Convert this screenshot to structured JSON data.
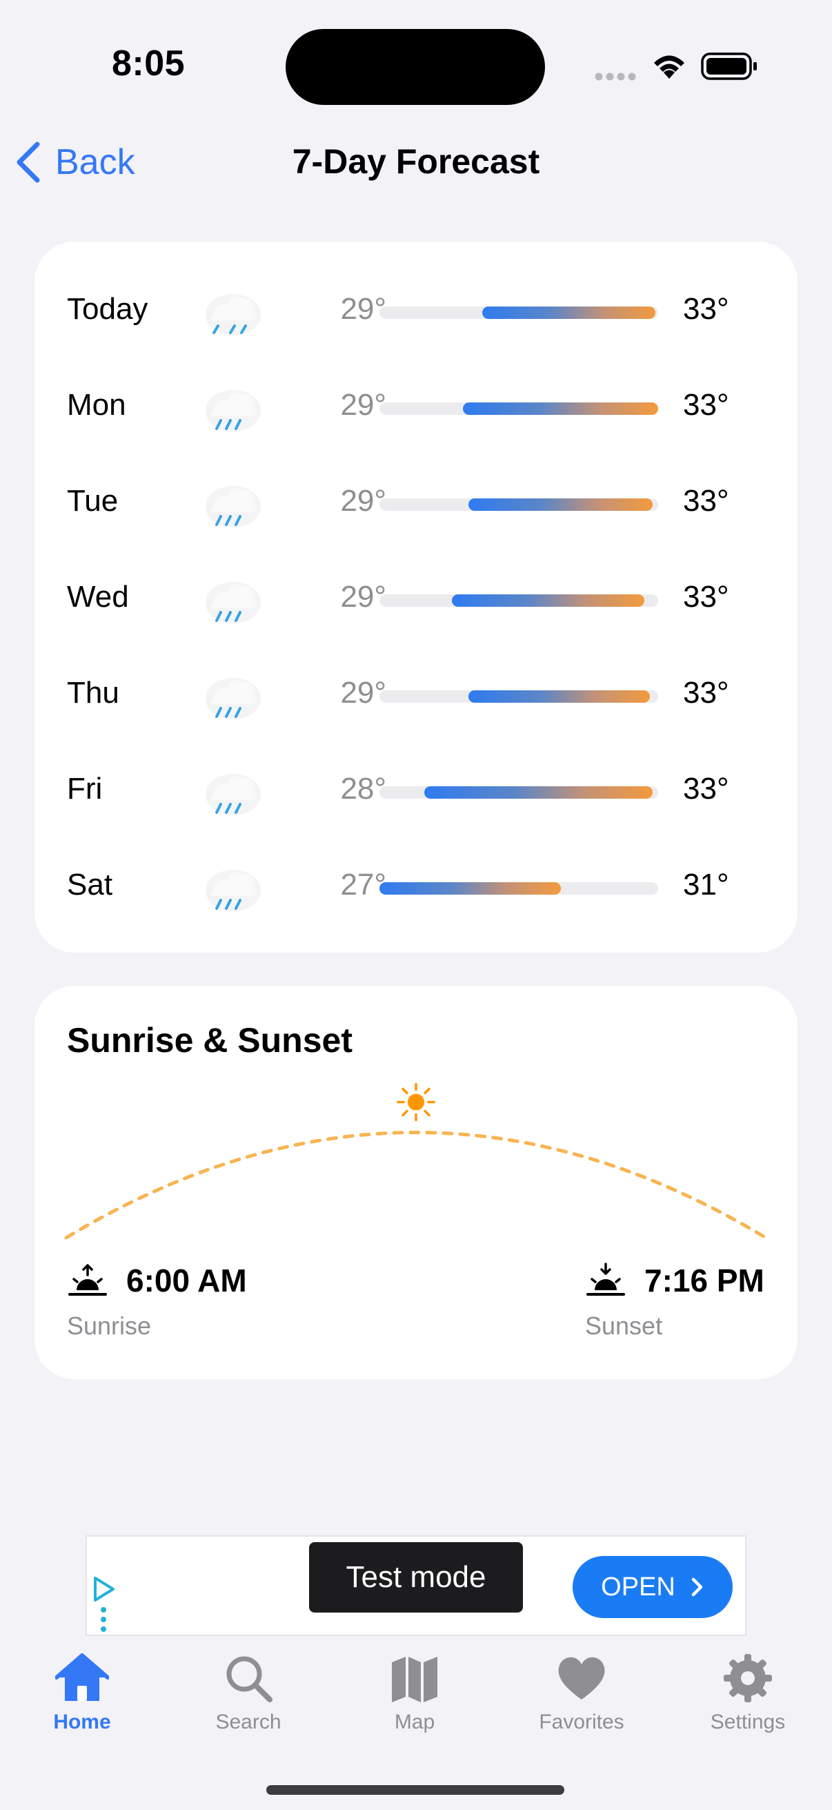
{
  "status_bar": {
    "time": "8:05"
  },
  "nav": {
    "back_label": "Back",
    "title": "7-Day Forecast"
  },
  "forecast": {
    "days": [
      {
        "name": "Today",
        "icon": "rain-icon",
        "low": "29°",
        "high": "33°",
        "bar_start_pct": 37,
        "bar_end_pct": 99
      },
      {
        "name": "Mon",
        "icon": "rain-icon",
        "low": "29°",
        "high": "33°",
        "bar_start_pct": 30,
        "bar_end_pct": 100
      },
      {
        "name": "Tue",
        "icon": "rain-icon",
        "low": "29°",
        "high": "33°",
        "bar_start_pct": 32,
        "bar_end_pct": 98
      },
      {
        "name": "Wed",
        "icon": "rain-icon",
        "low": "29°",
        "high": "33°",
        "bar_start_pct": 26,
        "bar_end_pct": 95
      },
      {
        "name": "Thu",
        "icon": "rain-icon",
        "low": "29°",
        "high": "33°",
        "bar_start_pct": 32,
        "bar_end_pct": 97
      },
      {
        "name": "Fri",
        "icon": "rain-icon",
        "low": "28°",
        "high": "33°",
        "bar_start_pct": 16,
        "bar_end_pct": 98
      },
      {
        "name": "Sat",
        "icon": "rain-icon",
        "low": "27°",
        "high": "31°",
        "bar_start_pct": 0,
        "bar_end_pct": 65
      }
    ]
  },
  "sun": {
    "title": "Sunrise & Sunset",
    "sunrise_time": "6:00 AM",
    "sunrise_label": "Sunrise",
    "sunset_time": "7:16 PM",
    "sunset_label": "Sunset",
    "sun_position_pct": 50,
    "arc_color": "#F7B451",
    "sun_color": "#FF9500"
  },
  "ad": {
    "test_mode_label": "Test mode",
    "open_label": "OPEN"
  },
  "tabs": [
    {
      "label": "Home",
      "icon": "house-icon"
    },
    {
      "label": "Search",
      "icon": "magnifier-icon"
    },
    {
      "label": "Map",
      "icon": "map-icon"
    },
    {
      "label": "Favorites",
      "icon": "heart-icon"
    },
    {
      "label": "Settings",
      "icon": "gear-icon"
    }
  ],
  "active_tab": "Home",
  "colors": {
    "accent": "#3478F6",
    "background": "#F2F2F7",
    "bar_cold": "#2F7BF0",
    "bar_warm": "#F39A3D"
  }
}
